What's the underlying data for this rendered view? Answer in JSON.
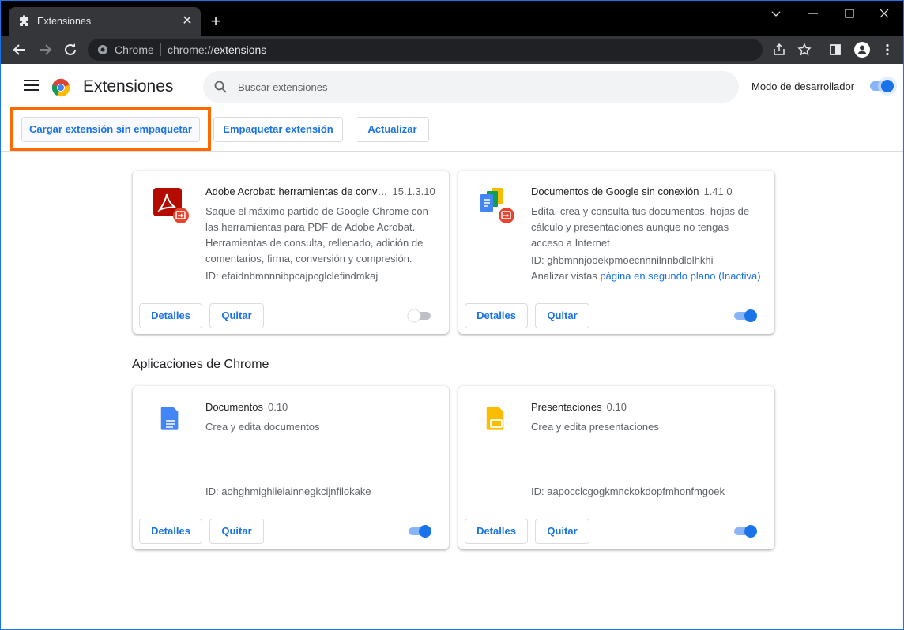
{
  "browser": {
    "tab_title": "Extensiones",
    "omnibox_site": "Chrome",
    "url_prefix": "chrome://",
    "url_path": "extensions"
  },
  "header": {
    "title": "Extensiones",
    "search_placeholder": "Buscar extensiones",
    "dev_mode_label": "Modo de desarrollador",
    "dev_mode_on": true
  },
  "actions": {
    "load_unpacked": "Cargar extensión sin empaquetar",
    "pack": "Empaquetar extensión",
    "update": "Actualizar"
  },
  "extensions": [
    {
      "name": "Adobe Acrobat: herramientas de conv…",
      "version": "15.1.3.10",
      "description": "Saque el máximo partido de Google Chrome con las herramientas para PDF de Adobe Acrobat. Herramientas de consulta, rellenado, adición de comentarios, firma, conversión y compresión.",
      "id": "ID: efaidnbmnnnibpcajpcglclefindmkaj",
      "enabled": false,
      "details_label": "Detalles",
      "remove_label": "Quitar"
    },
    {
      "name": "Documentos de Google sin conexión",
      "version": "1.41.0",
      "description": "Edita, crea y consulta tus documentos, hojas de cálculo y presentaciones aunque no tengas acceso a Internet",
      "id": "ID: ghbmnnjooekpmoecnnnilnnbdlolhkhi",
      "views_label": "Analizar vistas",
      "views_link": "página en segundo plano (Inactiva)",
      "enabled": true,
      "details_label": "Detalles",
      "remove_label": "Quitar"
    }
  ],
  "apps_section_title": "Aplicaciones de Chrome",
  "apps": [
    {
      "name": "Documentos",
      "version": "0.10",
      "description": "Crea y edita documentos",
      "id": "ID: aohghmighlieiainnegkcijnfilokake",
      "enabled": true,
      "details_label": "Detalles",
      "remove_label": "Quitar"
    },
    {
      "name": "Presentaciones",
      "version": "0.10",
      "description": "Crea y edita presentaciones",
      "id": "ID: aapocclcgogkmnckokdopfmhonfmgoek",
      "enabled": true,
      "details_label": "Detalles",
      "remove_label": "Quitar"
    }
  ],
  "colors": {
    "accent": "#1a73e8",
    "highlight": "#ff6a00",
    "titlebar": "#000000",
    "toolbar": "#35363a"
  }
}
